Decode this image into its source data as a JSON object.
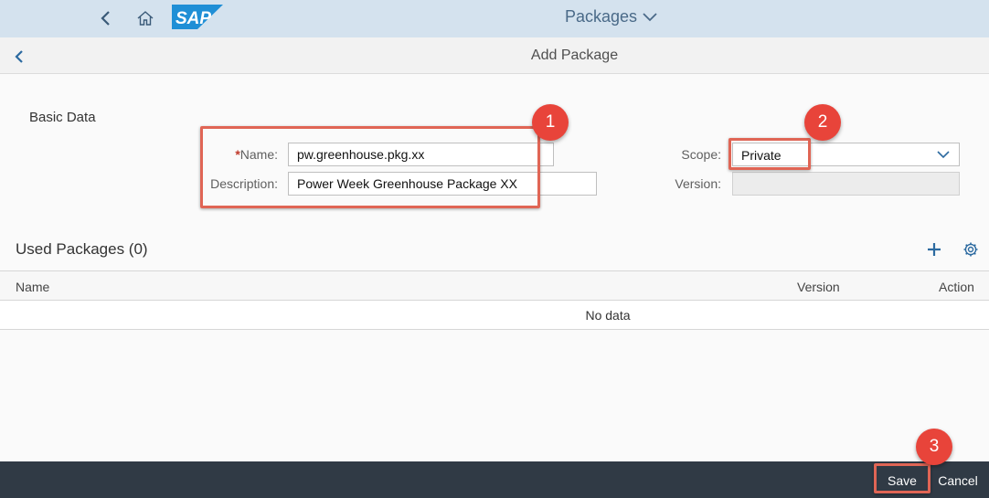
{
  "shell": {
    "app_title": "Packages",
    "logo_text": "SAP"
  },
  "page": {
    "title": "Add Package"
  },
  "basic_data": {
    "section_title": "Basic Data",
    "name_required_mark": "*",
    "name_label": "Name:",
    "name_value": "pw.greenhouse.pkg.xx",
    "description_label": "Description:",
    "description_value": "Power Week Greenhouse Package XX",
    "scope_label": "Scope:",
    "scope_value": "Private",
    "version_label": "Version:",
    "version_value": ""
  },
  "used_packages": {
    "title": "Used Packages (0)",
    "columns": [
      "Name",
      "Version",
      "Action"
    ],
    "empty_text": "No data"
  },
  "footer": {
    "save_label": "Save",
    "cancel_label": "Cancel"
  },
  "callouts": [
    "1",
    "2",
    "3"
  ],
  "colors": {
    "shellbar": "#d4e2ee",
    "highlight": "#e06555",
    "callout": "#e8443a",
    "footer": "#303a45",
    "sap_blue": "#1f8fd6"
  }
}
